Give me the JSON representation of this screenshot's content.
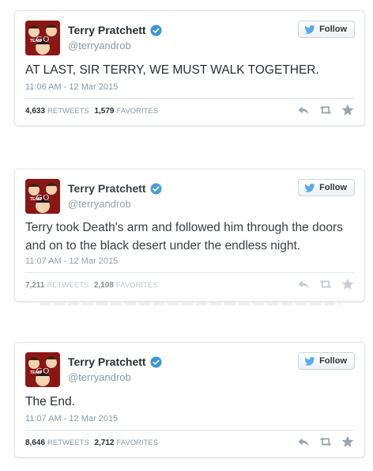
{
  "tweets": [
    {
      "name": "Terry Pratchett",
      "handle": "@terryandrob",
      "follow_label": "Follow",
      "text": "AT LAST, SIR TERRY, WE MUST WALK TOGETHER.",
      "date": "11:06 AM - 12 Mar 2015",
      "retweets": "4,633",
      "retweets_label": "RETWEETS",
      "favorites": "1,579",
      "favorites_label": "FAVORITES"
    },
    {
      "name": "Terry Pratchett",
      "handle": "@terryandrob",
      "follow_label": "Follow",
      "text": "Terry took Death's arm and followed him through the doors and on to the black desert under the endless night.",
      "date": "11:07 AM - 12 Mar 2015",
      "retweets": "7,211",
      "retweets_label": "RETWEETS",
      "favorites": "2,108",
      "favorites_label": "FAVORITES"
    },
    {
      "name": "Terry Pratchett",
      "handle": "@terryandrob",
      "follow_label": "Follow",
      "text": "The End.",
      "date": "11:07 AM - 12 Mar 2015",
      "retweets": "8,646",
      "retweets_label": "RETWEETS",
      "favorites": "2,712",
      "favorites_label": "FAVORITES"
    }
  ],
  "avatar_text": "TEAM GO",
  "icons": {
    "verified": "verified-badge-icon",
    "follow": "twitter-bird-icon",
    "reply": "reply-icon",
    "retweet": "retweet-icon",
    "favorite": "star-icon"
  },
  "colors": {
    "twitter_blue": "#55acee",
    "verified_blue": "#3b94d9",
    "muted_text": "#8899a6",
    "border": "#e1e8ed",
    "action_gray": "#9aa5ae"
  }
}
